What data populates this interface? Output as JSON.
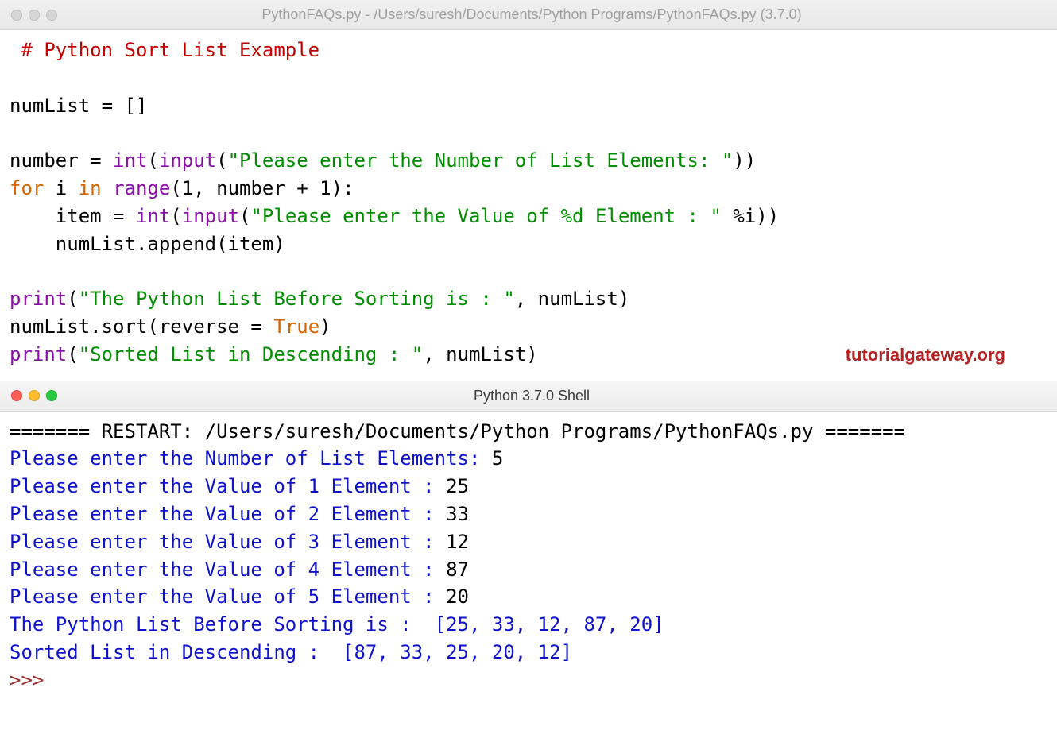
{
  "editor": {
    "title": "PythonFAQs.py - /Users/suresh/Documents/Python Programs/PythonFAQs.py (3.7.0)",
    "watermark": "tutorialgateway.org",
    "code": {
      "l1": " # Python Sort List Example",
      "l2": "",
      "l3a": "numList = []",
      "l4": "",
      "l5_number": "number = ",
      "l5_int": "int",
      "l5_p1": "(",
      "l5_input": "input",
      "l5_p2": "(",
      "l5_str": "\"Please enter the Number of List Elements: \"",
      "l5_end": "))",
      "l6_for": "for",
      "l6_sp1": " i ",
      "l6_in": "in",
      "l6_sp2": " ",
      "l6_range": "range",
      "l6_rest": "(1, number + 1):",
      "l7_pre": "    item = ",
      "l7_int": "int",
      "l7_p1": "(",
      "l7_input": "input",
      "l7_p2": "(",
      "l7_str": "\"Please enter the Value of %d Element : \"",
      "l7_end": " %i))",
      "l8": "    numList.append(item)",
      "l9": "",
      "l10_print": "print",
      "l10_p1": "(",
      "l10_str": "\"The Python List Before Sorting is : \"",
      "l10_end": ", numList)",
      "l11_a": "numList.sort(reverse = ",
      "l11_true": "True",
      "l11_b": ")",
      "l12_print": "print",
      "l12_p1": "(",
      "l12_str": "\"Sorted List in Descending : \"",
      "l12_end": ", numList)"
    }
  },
  "shell": {
    "title": "Python 3.7.0 Shell",
    "restart": "======= RESTART: /Users/suresh/Documents/Python Programs/PythonFAQs.py =======",
    "lines": {
      "p1": "Please enter the Number of List Elements: ",
      "v1": "5",
      "p2": "Please enter the Value of 1 Element : ",
      "v2": "25",
      "p3": "Please enter the Value of 2 Element : ",
      "v3": "33",
      "p4": "Please enter the Value of 3 Element : ",
      "v4": "12",
      "p5": "Please enter the Value of 4 Element : ",
      "v5": "87",
      "p6": "Please enter the Value of 5 Element : ",
      "v6": "20",
      "out1": "The Python List Before Sorting is :  [25, 33, 12, 87, 20]",
      "out2": "Sorted List in Descending :  [87, 33, 25, 20, 12]",
      "prompt": ">>> "
    }
  }
}
